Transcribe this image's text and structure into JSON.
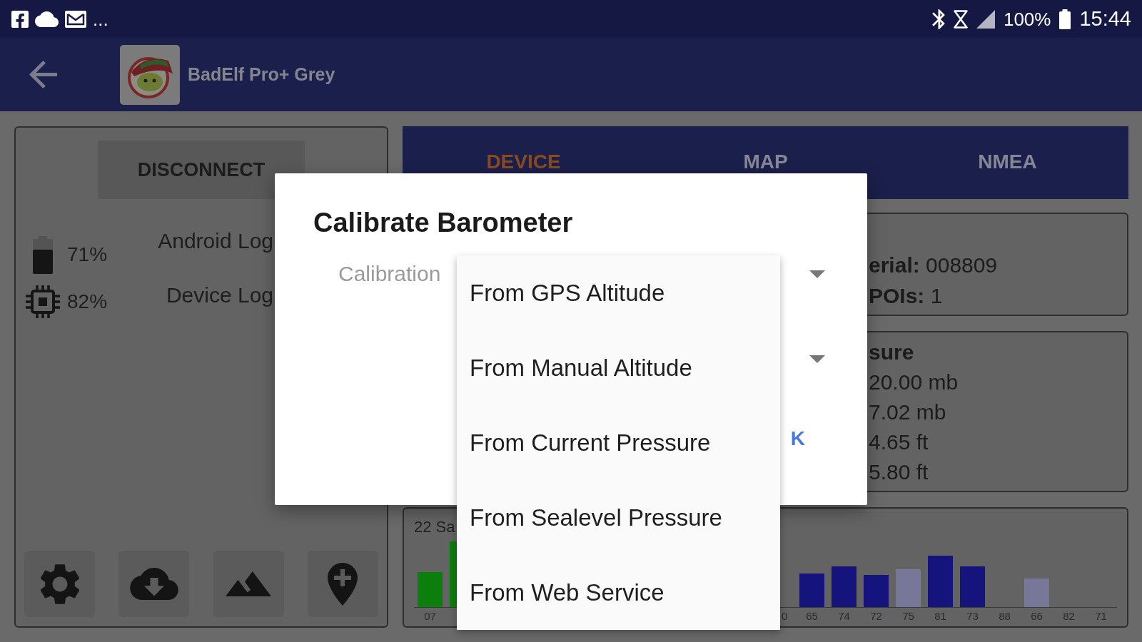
{
  "status_bar": {
    "overflow": "...",
    "battery": "100%",
    "time": "15:44"
  },
  "app_bar": {
    "title": "BadElf Pro+ Grey"
  },
  "left_panel": {
    "disconnect": "DISCONNECT",
    "stats": [
      "71%",
      "82%"
    ],
    "logs": [
      "Android Log",
      "Device Log"
    ]
  },
  "tabs": [
    {
      "label": "DEVICE",
      "selected": true
    },
    {
      "label": "MAP",
      "selected": false
    },
    {
      "label": "NMEA",
      "selected": false
    }
  ],
  "info_card": {
    "lines": [
      "**erial:** 008809",
      "**POIs:** 1"
    ]
  },
  "pressure_card": {
    "title": "sure",
    "lines": [
      "20.00 mb",
      "7.02 mb",
      "4.65 ft",
      "5.80 ft"
    ]
  },
  "signal_chart": {
    "title": "22 Sa",
    "groups": [
      [
        {
          "kind": "bar",
          "label": "07",
          "level": 0.49,
          "color": "#0c7e0c"
        },
        {
          "kind": "cut",
          "level": 0.92,
          "color": "#0c7e0c"
        }
      ],
      [
        {
          "kind": "cut",
          "label": "0"
        },
        {
          "kind": "bar",
          "label": "65",
          "level": 0.47,
          "color": "#14147c"
        },
        {
          "kind": "bar",
          "label": "74",
          "level": 0.57,
          "color": "#14147c"
        },
        {
          "kind": "bar",
          "label": "72",
          "level": 0.45,
          "color": "#14147c"
        },
        {
          "kind": "bar",
          "label": "75",
          "level": 0.53,
          "color": "#77779a"
        },
        {
          "kind": "bar",
          "label": "81",
          "level": 0.72,
          "color": "#14147c"
        },
        {
          "kind": "bar",
          "label": "73",
          "level": 0.57,
          "color": "#14147c"
        },
        {
          "kind": "bar",
          "label": "88"
        },
        {
          "kind": "bar",
          "label": "66",
          "level": 0.4,
          "color": "#77779a"
        },
        {
          "kind": "bar",
          "label": "82"
        },
        {
          "kind": "bar",
          "label": "71"
        }
      ]
    ]
  },
  "dialog": {
    "title": "Calibrate Barometer",
    "field_label": "Calibration",
    "button": "K"
  },
  "menu": {
    "items": [
      {
        "label": "From GPS Altitude",
        "selected": false
      },
      {
        "label": "From Manual Altitude",
        "selected": false
      },
      {
        "label": "From Current Pressure",
        "selected": false
      },
      {
        "label": "From Sealevel Pressure",
        "selected": false
      },
      {
        "label": "From Web Service",
        "selected": false
      }
    ]
  }
}
